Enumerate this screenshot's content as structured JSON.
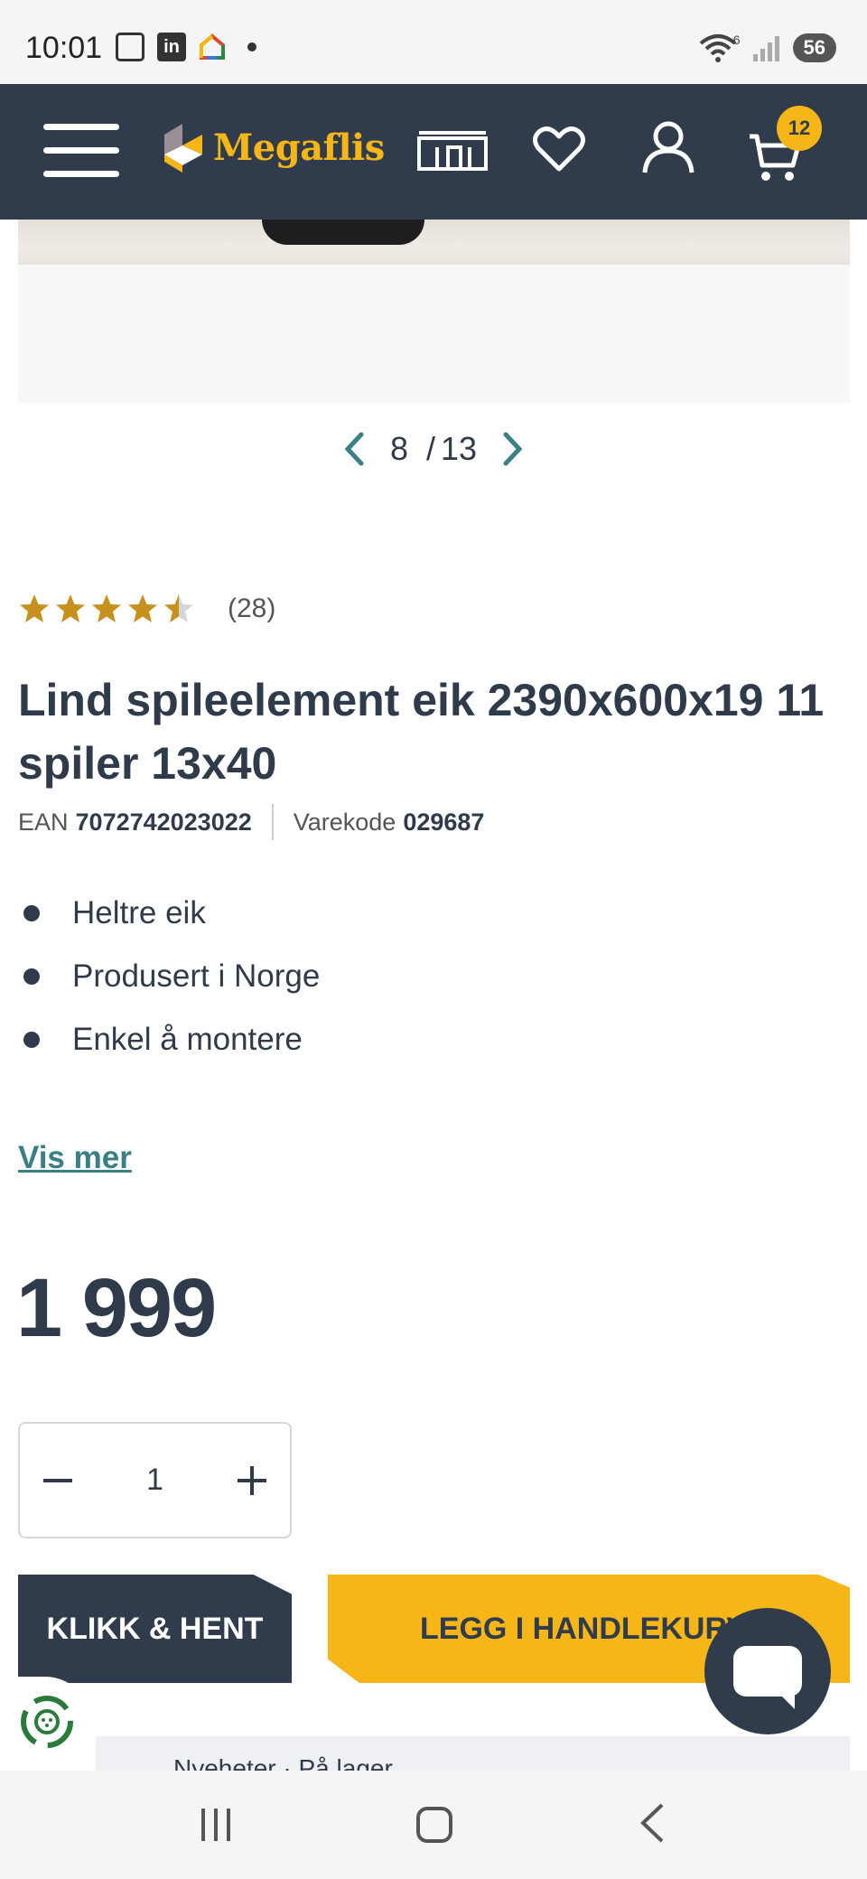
{
  "status_bar": {
    "time": "10:01",
    "battery": "56",
    "network_badge": "6"
  },
  "header": {
    "logo_text": "Megaflis",
    "cart_count": "12"
  },
  "gallery": {
    "current": "8",
    "separator": "/",
    "total": "13"
  },
  "product": {
    "rating_stars": 4.5,
    "rating_max": 5,
    "review_count": "(28)",
    "title": "Lind spileelement eik 2390x600x19 11 spiler 13x40",
    "ean_label": "EAN",
    "ean_value": "7072742023022",
    "sku_label": "Varekode",
    "sku_value": "029687",
    "bullets": [
      "Heltre eik",
      "Produsert i Norge",
      "Enkel å montere"
    ],
    "more_link": "Vis mer",
    "price": "1 999"
  },
  "quantity": {
    "value": "1"
  },
  "buttons": {
    "click_collect": "KLIKK & HENT",
    "add_to_cart": "LEGG I HANDLEKURV"
  },
  "bottom_card": {
    "text": "Nyeheter · På lager"
  },
  "colors": {
    "brand_dark": "#303c4b",
    "brand_yellow": "#f7b617",
    "link_teal": "#3b7f86",
    "star": "#c8901c"
  }
}
